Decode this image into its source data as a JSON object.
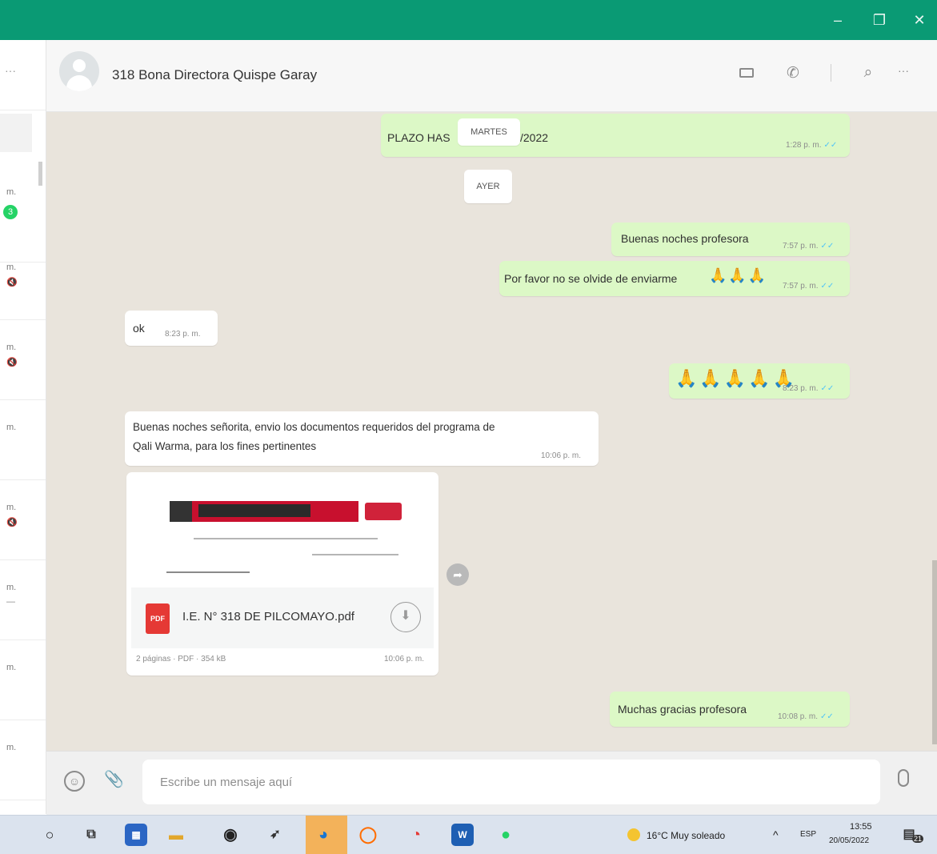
{
  "window": {
    "minimize": "–",
    "maximize": "❐",
    "close": "✕"
  },
  "sidebar": {
    "more": "···",
    "items": [
      {
        "time": "m.",
        "badge": "3"
      },
      {
        "time": "m.",
        "icon": "🔇"
      },
      {
        "time": "m.",
        "icon": "🔇"
      },
      {
        "time": "m."
      },
      {
        "time": "m.",
        "icon": "🔇"
      },
      {
        "time": "m.",
        "icon": "—"
      },
      {
        "time": "m."
      },
      {
        "time": "m."
      }
    ]
  },
  "header": {
    "contact_name": "318 Bona Directora Quispe Garay",
    "more": "···"
  },
  "chat": {
    "messages": [
      {
        "dir": "out",
        "text": "PLAZO HAS",
        "text_after": "/2022",
        "time": "1:28 p. m."
      },
      {
        "dir": "out",
        "text": "Buenas noches profesora",
        "time": "7:57 p. m."
      },
      {
        "dir": "out",
        "text": "Por favor no se olvide de enviarme",
        "emoji": "🙏🙏🙏",
        "time": "7:57 p. m."
      },
      {
        "dir": "in",
        "text": "ok",
        "time": "8:23 p. m."
      },
      {
        "dir": "out",
        "emoji": "🙏🙏🙏🙏🙏",
        "time": "8:23 p. m."
      },
      {
        "dir": "in",
        "text": "Buenas noches señorita, envio los documentos requeridos del programa de",
        "text2": "Qali Warma, para los fines pertinentes",
        "time": "10:06 p. m."
      },
      {
        "dir": "out",
        "text": "Muchas gracias profesora",
        "time": "10:08 p. m."
      }
    ],
    "day_chips": [
      "MARTES",
      "AYER"
    ],
    "document": {
      "name": "I.E. N° 318 DE PILCOMAYO.pdf",
      "icon_label": "PDF",
      "meta": "2 páginas · PDF · 354 kB",
      "time": "10:06 p. m."
    }
  },
  "composer": {
    "placeholder": "Escribe un mensaje aquí"
  },
  "taskbar": {
    "weather": "16°C  Muy soleado",
    "tray_chevron": "^",
    "lang": "ESP",
    "time": "13:55",
    "date": "20/05/2022",
    "notif_count": "21"
  }
}
